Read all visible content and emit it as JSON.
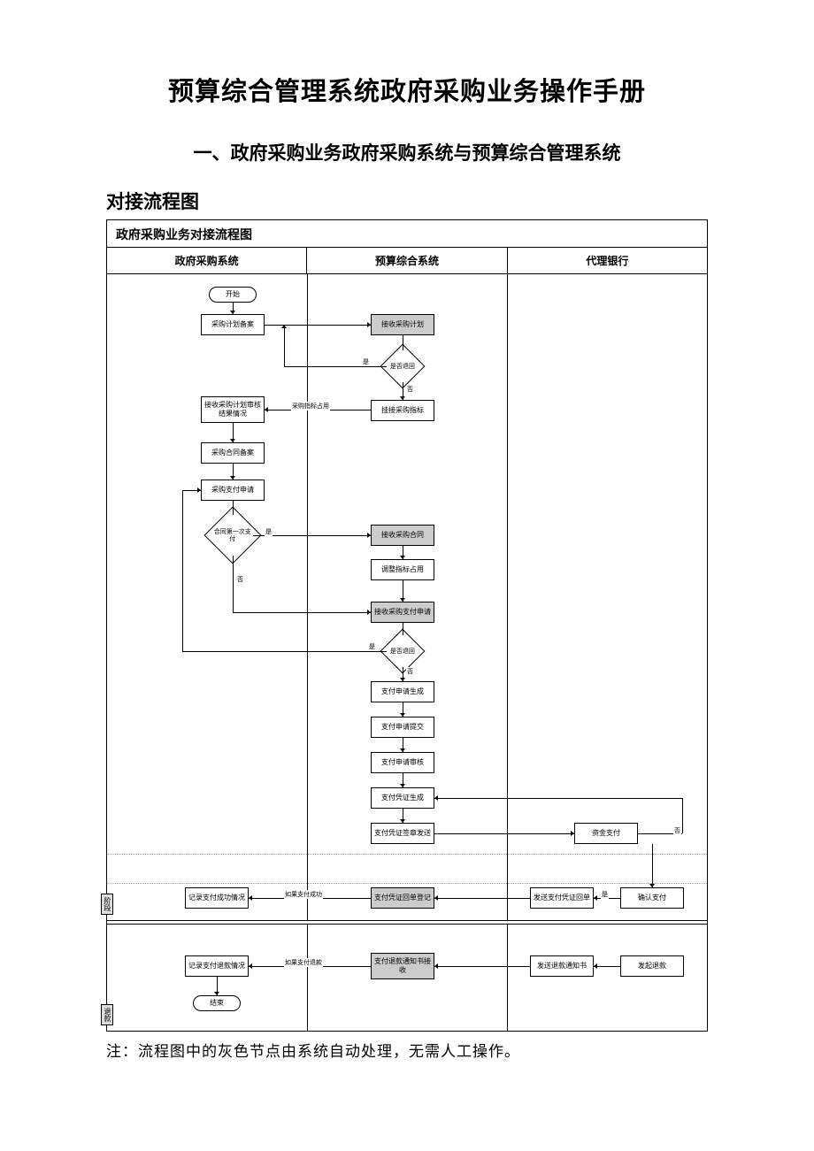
{
  "title": "预算综合管理系统政府采购业务操作手册",
  "section_heading": "一、政府采购业务政府采购系统与预算综合管理系统",
  "subheading": "对接流程图",
  "diagram": {
    "caption": "政府采购业务对接流程图",
    "lanes": [
      {
        "id": "lane-procurement",
        "label": "政府采购系统"
      },
      {
        "id": "lane-budget",
        "label": "预算综合系统"
      },
      {
        "id": "lane-bank",
        "label": "代理银行"
      }
    ],
    "phase_tabs": {
      "pay": "阶段",
      "refund": "退款"
    },
    "nodes": {
      "start": "开始",
      "plan_record": "采购计划备案",
      "recv_plan": "接收采购计划",
      "d_return": "是否退回",
      "recv_audit": "接收采购计划审核结果情况",
      "quota": "挂接采购指标",
      "contract_record": "采购合同备案",
      "pay_apply": "采购支付申请",
      "d_first_pay": "合同第一次支付",
      "recv_contract": "接收采购合同",
      "adjust_ratio": "调整指标占用",
      "recv_pay_apply": "接收采购支付申请",
      "d_return2": "是否退回",
      "pay_gen": "支付申请生成",
      "pay_submit": "支付申请提交",
      "pay_audit": "支付申请审核",
      "voucher_gen": "支付凭证生成",
      "voucher_sign": "支付凭证签章发送",
      "fund_pay": "资金支付",
      "confirm_pay": "确认支付",
      "send_voucher_receipt": "发送支付凭证回单",
      "voucher_receipt_reg": "支付凭证回单登记",
      "record_success": "记录支付成功情况",
      "record_refund": "记录支付退款情况",
      "refund_notice_recv": "支付退款通知书接收",
      "send_refund_notice": "发送退款通知书",
      "init_refund": "发起退款",
      "end": "结束"
    },
    "edge_labels": {
      "yes": "是",
      "no": "否",
      "return_quota": "采购指标占用",
      "if_pay_success": "如果支付成功",
      "if_pay_refund": "如果支付退款"
    }
  },
  "footnote": "注：流程图中的灰色节点由系统自动处理，无需人工操作。"
}
